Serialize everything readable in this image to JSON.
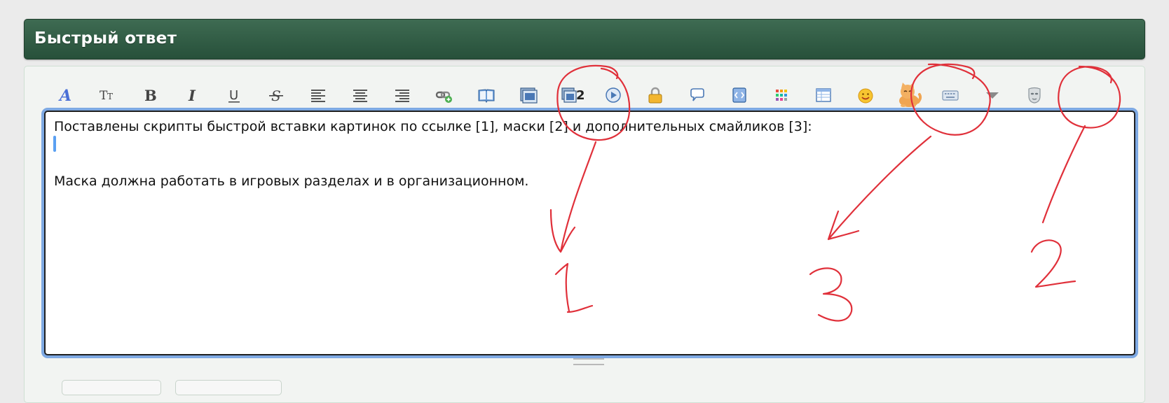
{
  "top_partial_text": "",
  "header": {
    "title": "Быстрый ответ"
  },
  "toolbar": {
    "buttons": [
      {
        "name": "font-color-button",
        "icon": "font-color-icon"
      },
      {
        "name": "font-size-button",
        "icon": "text-size-icon",
        "glyph": "Tт"
      },
      {
        "name": "bold-button",
        "icon": "bold-icon",
        "glyph": "B"
      },
      {
        "name": "italic-button",
        "icon": "italic-icon",
        "glyph": "I"
      },
      {
        "name": "underline-button",
        "icon": "underline-icon",
        "glyph": "U"
      },
      {
        "name": "strikethrough-button",
        "icon": "strikethrough-icon",
        "glyph": "S"
      },
      {
        "name": "align-left-button",
        "icon": "align-left-icon"
      },
      {
        "name": "align-center-button",
        "icon": "align-center-icon"
      },
      {
        "name": "align-right-button",
        "icon": "align-right-icon"
      },
      {
        "name": "insert-link-button",
        "icon": "link-icon"
      },
      {
        "name": "insert-quote-button",
        "icon": "book-icon"
      },
      {
        "name": "insert-image-button",
        "icon": "image-icon"
      },
      {
        "name": "insert-image-link-button",
        "icon": "image-link-icon",
        "glyph": "2"
      },
      {
        "name": "insert-video-button",
        "icon": "play-icon"
      },
      {
        "name": "hide-content-button",
        "icon": "lock-icon"
      },
      {
        "name": "insert-comment-button",
        "icon": "speech-bubble-icon"
      },
      {
        "name": "insert-code-button",
        "icon": "code-scroll-icon"
      },
      {
        "name": "color-palette-button",
        "icon": "palette-grid-icon"
      },
      {
        "name": "insert-table-button",
        "icon": "table-icon"
      },
      {
        "name": "smilies-button",
        "icon": "smiley-icon"
      },
      {
        "name": "extra-smilies-button",
        "icon": "cat-icon"
      },
      {
        "name": "keyboard-button",
        "icon": "keyboard-icon"
      },
      {
        "name": "more-button",
        "icon": "triangle-down-icon"
      },
      {
        "name": "mask-button",
        "icon": "mask-icon"
      }
    ]
  },
  "editor": {
    "line1": "Поставлены скрипты быстрой вставки картинок по ссылке [1], маски [2] и дополнительных смайликов [3]:",
    "line3": "Маска должна работать в игровых разделах и в организационном."
  },
  "colors": {
    "header": "#2f5a43",
    "annotation": "#e0303a",
    "focus": "#7ea9e3"
  }
}
